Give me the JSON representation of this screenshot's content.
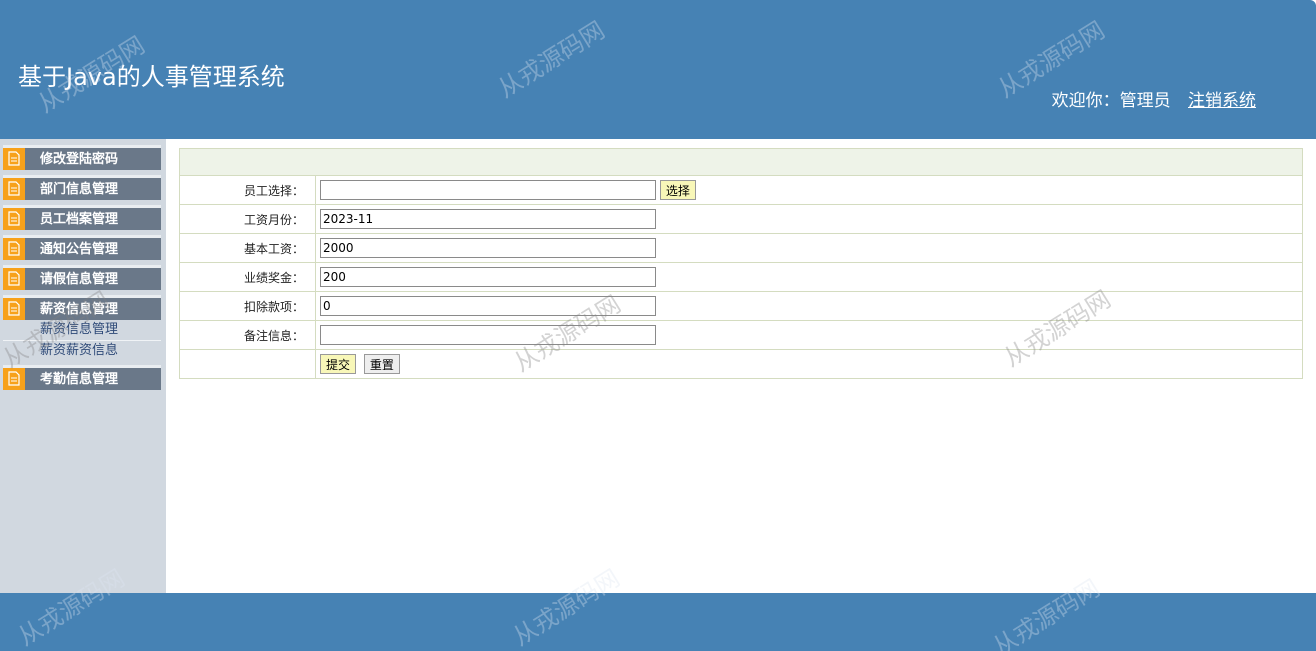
{
  "header": {
    "title": "基于Java的人事管理系统",
    "welcome": "欢迎你：管理员",
    "logout": "注销系统"
  },
  "sidebar": {
    "items": [
      {
        "label": "修改登陆密码"
      },
      {
        "label": "部门信息管理"
      },
      {
        "label": "员工档案管理"
      },
      {
        "label": "通知公告管理"
      },
      {
        "label": "请假信息管理"
      },
      {
        "label": "薪资信息管理"
      },
      {
        "label": "考勤信息管理"
      }
    ],
    "subitems": [
      {
        "label": "薪资信息管理"
      },
      {
        "label": "薪资薪资信息"
      }
    ]
  },
  "form": {
    "employee": {
      "label": "员工选择：",
      "value": "",
      "button": "选择"
    },
    "month": {
      "label": "工资月份：",
      "value": "2023-11"
    },
    "base": {
      "label": "基本工资：",
      "value": "2000"
    },
    "bonus": {
      "label": "业绩奖金：",
      "value": "200"
    },
    "deduction": {
      "label": "扣除款项：",
      "value": "0"
    },
    "note": {
      "label": "备注信息：",
      "value": ""
    },
    "submit": "提交",
    "reset": "重置"
  },
  "watermark": "从戎源码网",
  "colors": {
    "header_bg": "#4682b4",
    "sidebar_bg": "#d1d8e0",
    "menu_bg": "#6a7889",
    "menu_icon": "#f7a11a",
    "table_border": "#d4dcc0",
    "table_head_bg": "#eef3e8"
  }
}
